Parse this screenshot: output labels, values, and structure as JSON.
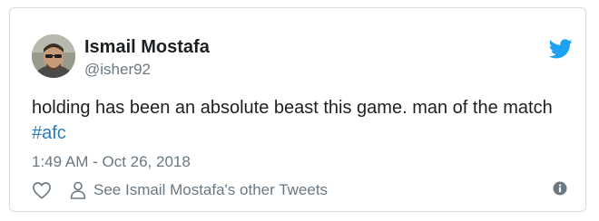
{
  "tweet": {
    "author": {
      "display_name": "Ismail Mostafa",
      "handle": "@isher92"
    },
    "text": "holding has been an absolute beast this game. man of the match ",
    "hashtag": "#afc",
    "timestamp": "1:49 AM - Oct 26, 2018"
  },
  "actions": {
    "like_icon": "heart-icon",
    "other_tweets_label": "See Ismail Mostafa's other Tweets",
    "info_icon": "info-icon"
  },
  "branding": {
    "logo": "twitter-bird-icon",
    "accent_color": "#1da1f2",
    "link_color": "#2b7bb9"
  }
}
